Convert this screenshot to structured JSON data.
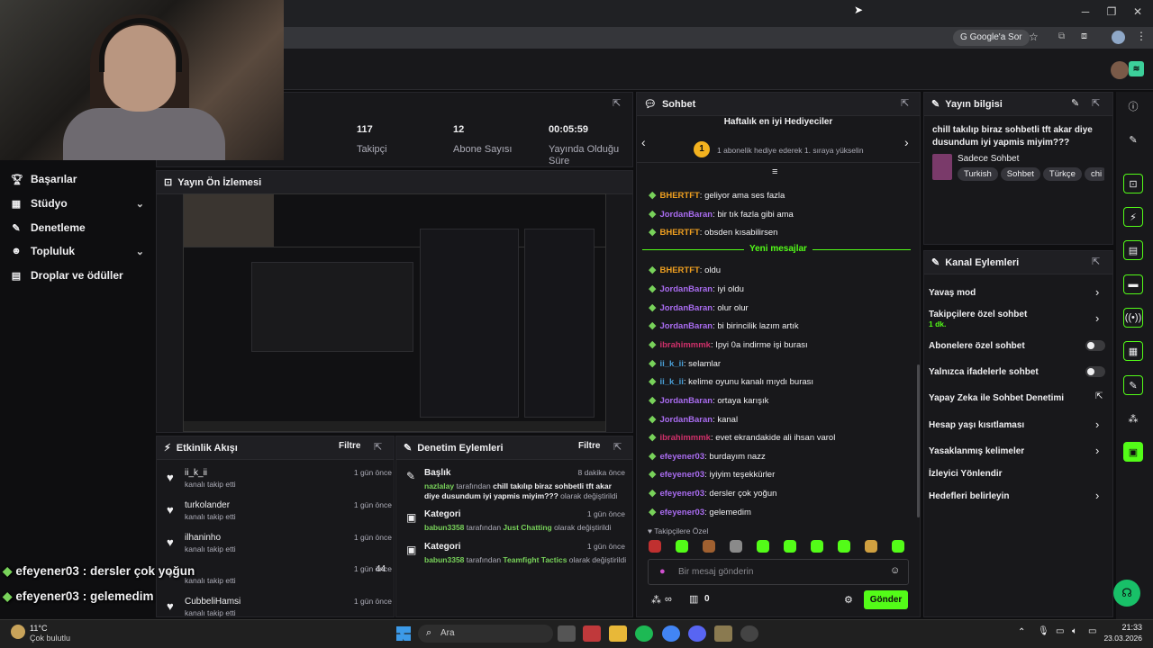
{
  "browser": {
    "google_chip": "Google'a Sor"
  },
  "stats": [
    {
      "value": "117",
      "label": "Takipçi"
    },
    {
      "value": "12",
      "label": "Abone Sayısı"
    },
    {
      "value": "00:05:59",
      "label": "Yayında Olduğu Süre"
    }
  ],
  "stats_partial_label": "i",
  "sidebar": {
    "items": [
      {
        "label": "Başarılar",
        "icon": "trophy-icon"
      },
      {
        "label": "Stüdyo",
        "icon": "studio-icon",
        "chevron": true
      },
      {
        "label": "Denetleme",
        "icon": "wrench-icon"
      },
      {
        "label": "Topluluk",
        "icon": "community-icon",
        "chevron": true
      },
      {
        "label": "Droplar ve ödüller",
        "icon": "drops-icon"
      }
    ]
  },
  "preview": {
    "title": "Yayın Ön İzlemesi"
  },
  "activity": {
    "title": "Etkinlik Akışı",
    "filter": "Filtre",
    "items": [
      {
        "name": "ii_k_ii",
        "sub": "kanalı takip etti",
        "time": "1 gün önce"
      },
      {
        "name": "turkolander",
        "sub": "kanalı takip etti",
        "time": "1 gün önce"
      },
      {
        "name": "ilhaninho",
        "sub": "kanalı takip etti",
        "time": "1 gün önce"
      },
      {
        "name": "44",
        "sub": "kanalı takip etti",
        "time": "1 gün önce"
      },
      {
        "name": "CubbeliHamsi",
        "sub": "kanalı takip etti",
        "time": "1 gün önce"
      }
    ]
  },
  "mod_actions": {
    "title": "Denetim Eylemleri",
    "filter": "Filtre",
    "items": [
      {
        "title": "Başlık",
        "time": "8 dakika önce",
        "user": "nazlalay",
        "mid": " tarafından ",
        "value": "chill takılıp biraz sohbetli tft akar diye dusundum iyi yapmis miyim???",
        "end": " olarak değiştirildi"
      },
      {
        "title": "Kategori",
        "time": "1 gün önce",
        "user": "babun3358",
        "mid": " tarafından ",
        "value": "Just Chatting",
        "end": " olarak değiştirildi"
      },
      {
        "title": "Kategori",
        "time": "1 gün önce",
        "user": "babun3358",
        "mid": " tarafından ",
        "value": "Teamfight Tactics",
        "end": " olarak değiştirildi"
      }
    ]
  },
  "chat": {
    "title": "Sohbet",
    "gifters_title": "Haftalık en iyi Hediyeciler",
    "gifters_rank": "1",
    "gifters_text": "1 abonelik hediye ederek 1. sıraya yükselin",
    "new_messages": "Yeni mesajlar",
    "messages": [
      {
        "user": "BHERTFT",
        "color": "#f0a020",
        "text": "geliyor ama ses fazla"
      },
      {
        "user": "JordanBaran",
        "color": "#a96cf0",
        "text": "bir tık fazla gibi ama"
      },
      {
        "user": "BHERTFT",
        "color": "#f0a020",
        "text": "obsden kısabilirsen"
      },
      {
        "user": "BHERTFT",
        "color": "#f0a020",
        "text": "oldu"
      },
      {
        "user": "JordanBaran",
        "color": "#a96cf0",
        "text": "iyi oldu"
      },
      {
        "user": "JordanBaran",
        "color": "#a96cf0",
        "text": "olur olur"
      },
      {
        "user": "JordanBaran",
        "color": "#a96cf0",
        "text": "bi birincilik lazım artık"
      },
      {
        "user": "ibrahimmmk",
        "color": "#d0306a",
        "text": "Ipyi 0a indirme işi burası"
      },
      {
        "user": "ii_k_ii",
        "color": "#4aa0d8",
        "text": "selamlar"
      },
      {
        "user": "ii_k_ii",
        "color": "#4aa0d8",
        "text": "kelime oyunu kanalı mıydı burası"
      },
      {
        "user": "JordanBaran",
        "color": "#a96cf0",
        "text": "ortaya karışık"
      },
      {
        "user": "JordanBaran",
        "color": "#a96cf0",
        "text": "kanal"
      },
      {
        "user": "ibrahimmmk",
        "color": "#d0306a",
        "text": "evet ekrandakide ali ihsan varol"
      },
      {
        "user": "efeyener03",
        "color": "#a96cf0",
        "text": "burdayım nazz"
      },
      {
        "user": "efeyener03",
        "color": "#a96cf0",
        "text": "iyiyim teşekkürler"
      },
      {
        "user": "efeyener03",
        "color": "#a96cf0",
        "text": "dersler çok yoğun"
      },
      {
        "user": "efeyener03",
        "color": "#a96cf0",
        "text": "gelemedim"
      }
    ],
    "followers_only": "Takipçilere Özel",
    "input_placeholder": "Bir mesaj gönderin",
    "points": "∞",
    "gift_count": "0",
    "send_label": "Gönder"
  },
  "stream_info": {
    "title": "Yayın bilgisi",
    "stream_title": "chill takılıp biraz sohbetli tft akar diye dusundum iyi yapmis miyim???",
    "category": "Sadece Sohbet",
    "tags": [
      "Turkish",
      "Sohbet",
      "Türkçe",
      "chi"
    ]
  },
  "channel_actions": {
    "title": "Kanal Eylemleri",
    "items": [
      {
        "label": "Yavaş mod",
        "control": "chevron"
      },
      {
        "label": "Takipçilere özel sohbet",
        "sub": "1 dk.",
        "control": "chevron"
      },
      {
        "label": "Abonelere özel sohbet",
        "control": "toggle"
      },
      {
        "label": "Yalnızca ifadelerle sohbet",
        "control": "toggle"
      },
      {
        "label": "Yapay Zeka ile Sohbet Denetimi",
        "control": "external"
      },
      {
        "label": "Hesap yaşı kısıtlaması",
        "control": "chevron"
      },
      {
        "label": "Yasaklanmış kelimeler",
        "control": "chevron"
      },
      {
        "label": "İzleyici Yönlendir",
        "control": "none"
      },
      {
        "label": "Hedefleri belirleyin",
        "control": "chevron"
      }
    ]
  },
  "overlay": [
    {
      "user": "efeyener03",
      "text": "dersler çok yoğun"
    },
    {
      "user": "efeyener03",
      "text": "gelemedim"
    }
  ],
  "taskbar": {
    "weather_temp": "11°C",
    "weather_desc": "Çok bulutlu",
    "search_placeholder": "Ara",
    "time": "21:33",
    "date": "23.03.2026"
  },
  "colors": {
    "accent": "#53fc18",
    "bg": "#0e0e10",
    "panel": "#18181b"
  }
}
